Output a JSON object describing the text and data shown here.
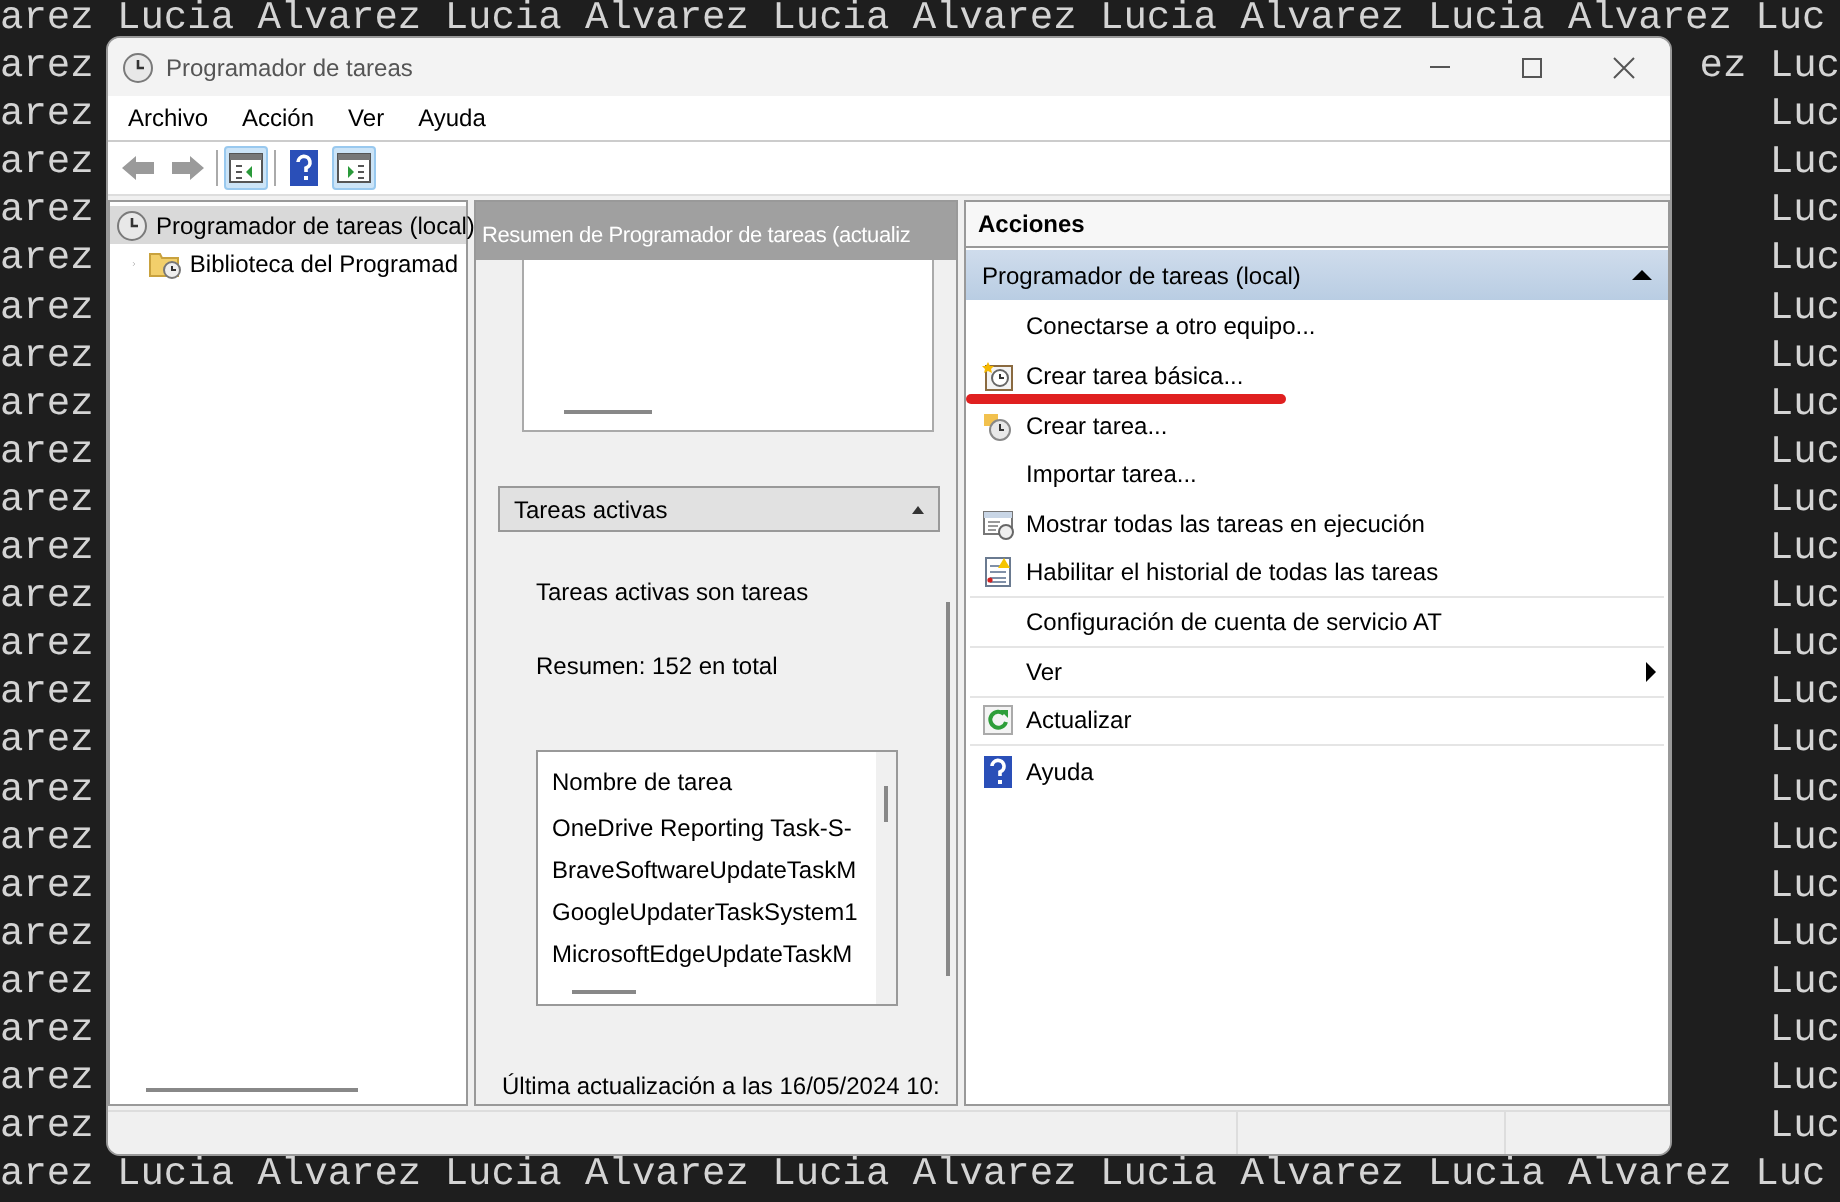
{
  "desktop": {
    "top_line": "arez Lucia Alvarez Lucia Alvarez Lucia Alvarez Lucia Alvarez Lucia Alvarez Luc",
    "rows": [
      {
        "left": "arez",
        "right": "ez Luc"
      },
      {
        "left": "arez",
        "right": "Luc"
      },
      {
        "left": "arez",
        "right": "Luc"
      },
      {
        "left": "arez",
        "right": "Luc"
      },
      {
        "left": "arez",
        "right": "Luc"
      },
      {
        "left": "arez",
        "right": "Luc"
      },
      {
        "left": "arez",
        "right": "Luc"
      },
      {
        "left": "arez",
        "right": "Luc"
      },
      {
        "left": "arez",
        "right": "Luc"
      },
      {
        "left": "arez",
        "right": "Luc"
      },
      {
        "left": "arez",
        "right": "Luc"
      },
      {
        "left": "arez",
        "right": "Luc"
      },
      {
        "left": "arez",
        "right": "Luc"
      },
      {
        "left": "arez",
        "right": "Luc"
      },
      {
        "left": "arez",
        "right": "Luc"
      },
      {
        "left": "arez",
        "right": "Luc"
      },
      {
        "left": "arez",
        "right": "Luc"
      },
      {
        "left": "arez",
        "right": "Luc"
      },
      {
        "left": "arez",
        "right": "Luc"
      },
      {
        "left": "arez",
        "right": "Luc"
      },
      {
        "left": "arez",
        "right": "Luc"
      },
      {
        "left": "arez",
        "right": "Luc"
      },
      {
        "left": "arez",
        "right": "Luc"
      }
    ],
    "bottom_line": "arez Lucia Alvarez Lucia Alvarez Lucia Alvarez Lucia Alvarez Lucia Alvarez Luc"
  },
  "window": {
    "title": "Programador de tareas"
  },
  "menu": [
    "Archivo",
    "Acción",
    "Ver",
    "Ayuda"
  ],
  "toolbar": [
    {
      "kind": "back",
      "pressed": false
    },
    {
      "kind": "forward",
      "pressed": false
    },
    {
      "kind": "tree",
      "pressed": true
    },
    {
      "kind": "help",
      "pressed": false
    },
    {
      "kind": "pane",
      "pressed": true
    }
  ],
  "tree": [
    {
      "label": "Programador de tareas (local)",
      "selected": true,
      "children": [
        {
          "label": "Biblioteca del Programad",
          "selected": false,
          "expanded": false
        }
      ]
    }
  ],
  "summary": {
    "header": "Resumen de Programador de tareas (actualiz",
    "active_section": {
      "title": "Tareas activas",
      "expanded": true,
      "description": "Tareas activas son tareas",
      "total": "Resumen: 152 en total",
      "list_header": "Nombre de tarea",
      "tasks": [
        "OneDrive Reporting Task-S-",
        "BraveSoftwareUpdateTaskM",
        "GoogleUpdaterTaskSystem1",
        "MicrosoftEdgeUpdateTaskM"
      ]
    },
    "last_update": "Última actualización a las 16/05/2024 10:"
  },
  "actions": {
    "title": "Acciones",
    "section": {
      "title": "Programador de tareas (local)",
      "expanded": true
    },
    "items": [
      {
        "label": "Conectarse a otro equipo...",
        "divider": false,
        "submenu": false,
        "underlined": false
      },
      {
        "label": "Crear tarea básica...",
        "divider": false,
        "submenu": false,
        "underlined": true
      },
      {
        "label": "Crear tarea...",
        "divider": false,
        "submenu": false,
        "underlined": false
      },
      {
        "label": "Importar tarea...",
        "divider": false,
        "submenu": false,
        "underlined": false
      },
      {
        "label": "Mostrar todas las tareas en ejecución",
        "divider": false,
        "submenu": false,
        "underlined": false
      },
      {
        "label": "Habilitar el historial de todas las tareas",
        "divider": true,
        "submenu": false,
        "underlined": false
      },
      {
        "label": "Configuración de cuenta de servicio AT",
        "divider": true,
        "submenu": false,
        "underlined": false
      },
      {
        "label": "Ver",
        "divider": true,
        "submenu": true,
        "underlined": false
      },
      {
        "label": "Actualizar",
        "divider": true,
        "submenu": false,
        "underlined": false
      },
      {
        "label": "Ayuda",
        "divider": false,
        "submenu": false,
        "underlined": false
      }
    ]
  }
}
